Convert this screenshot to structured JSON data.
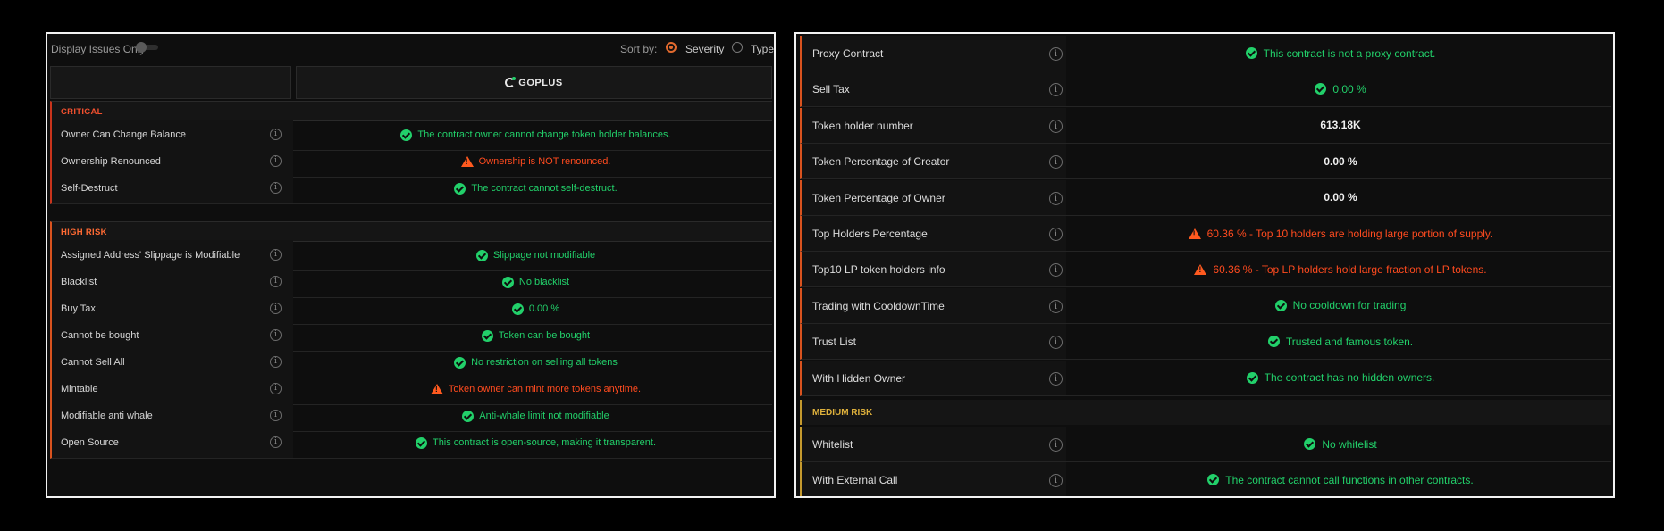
{
  "left": {
    "filter_label": "Display Issues Only",
    "sort_label": "Sort by:",
    "sort_options": [
      "Severity",
      "Type"
    ],
    "provider": "GOPLUS",
    "sections": {
      "critical": "CRITICAL",
      "high": "HIGH RISK"
    },
    "rows": [
      {
        "label": "Owner Can Change Balance",
        "status": "ok",
        "value": "The contract owner cannot change token holder balances."
      },
      {
        "label": "Ownership Renounced",
        "status": "warn",
        "value": "Ownership is NOT renounced."
      },
      {
        "label": "Self-Destruct",
        "status": "ok",
        "value": "The contract cannot self-destruct."
      },
      {
        "label": "Assigned Address' Slippage is Modifiable",
        "status": "ok",
        "value": "Slippage not modifiable"
      },
      {
        "label": "Blacklist",
        "status": "ok",
        "value": "No blacklist"
      },
      {
        "label": "Buy Tax",
        "status": "ok",
        "value": "0.00 %"
      },
      {
        "label": "Cannot be bought",
        "status": "ok",
        "value": "Token can be bought"
      },
      {
        "label": "Cannot Sell All",
        "status": "ok",
        "value": "No restriction on selling all tokens"
      },
      {
        "label": "Mintable",
        "status": "warn",
        "value": "Token owner can mint more tokens anytime."
      },
      {
        "label": "Modifiable anti whale",
        "status": "ok",
        "value": "Anti-whale limit not modifiable"
      },
      {
        "label": "Open Source",
        "status": "ok",
        "value": "This contract is open-source, making it transparent."
      }
    ]
  },
  "right": {
    "rows": [
      {
        "label": "Proxy Contract",
        "status": "ok",
        "value": "This contract is not a proxy contract."
      },
      {
        "label": "Sell Tax",
        "status": "ok",
        "value": "0.00 %"
      },
      {
        "label": "Token holder number",
        "status": "plain",
        "value": "613.18K"
      },
      {
        "label": "Token Percentage of Creator",
        "status": "plain",
        "value": "0.00 %"
      },
      {
        "label": "Token Percentage of Owner",
        "status": "plain",
        "value": "0.00 %"
      },
      {
        "label": "Top Holders Percentage",
        "status": "warn",
        "value": "60.36 % - Top 10 holders are holding large portion of supply."
      },
      {
        "label": "Top10 LP token holders info",
        "status": "warn",
        "value": "60.36 % - Top LP holders hold large fraction of LP tokens."
      },
      {
        "label": "Trading with CooldownTime",
        "status": "ok",
        "value": "No cooldown for trading"
      },
      {
        "label": "Trust List",
        "status": "ok",
        "value": "Trusted and famous token."
      },
      {
        "label": "With Hidden Owner",
        "status": "ok",
        "value": "The contract has no hidden owners."
      }
    ],
    "medium_section": "MEDIUM RISK",
    "medium_rows": [
      {
        "label": "Whitelist",
        "status": "ok",
        "value": "No whitelist"
      },
      {
        "label": "With External Call",
        "status": "ok",
        "value": "The contract cannot call functions in other contracts."
      }
    ]
  },
  "colors": {
    "ok": "#22d06a",
    "warn": "#ff4b1f",
    "critical": "#f2502e",
    "high": "#ff6a33",
    "medium": "#e0b23c"
  },
  "icons": {
    "ok": "check-circle-icon",
    "warn": "warning-triangle-icon",
    "info": "info-icon"
  }
}
